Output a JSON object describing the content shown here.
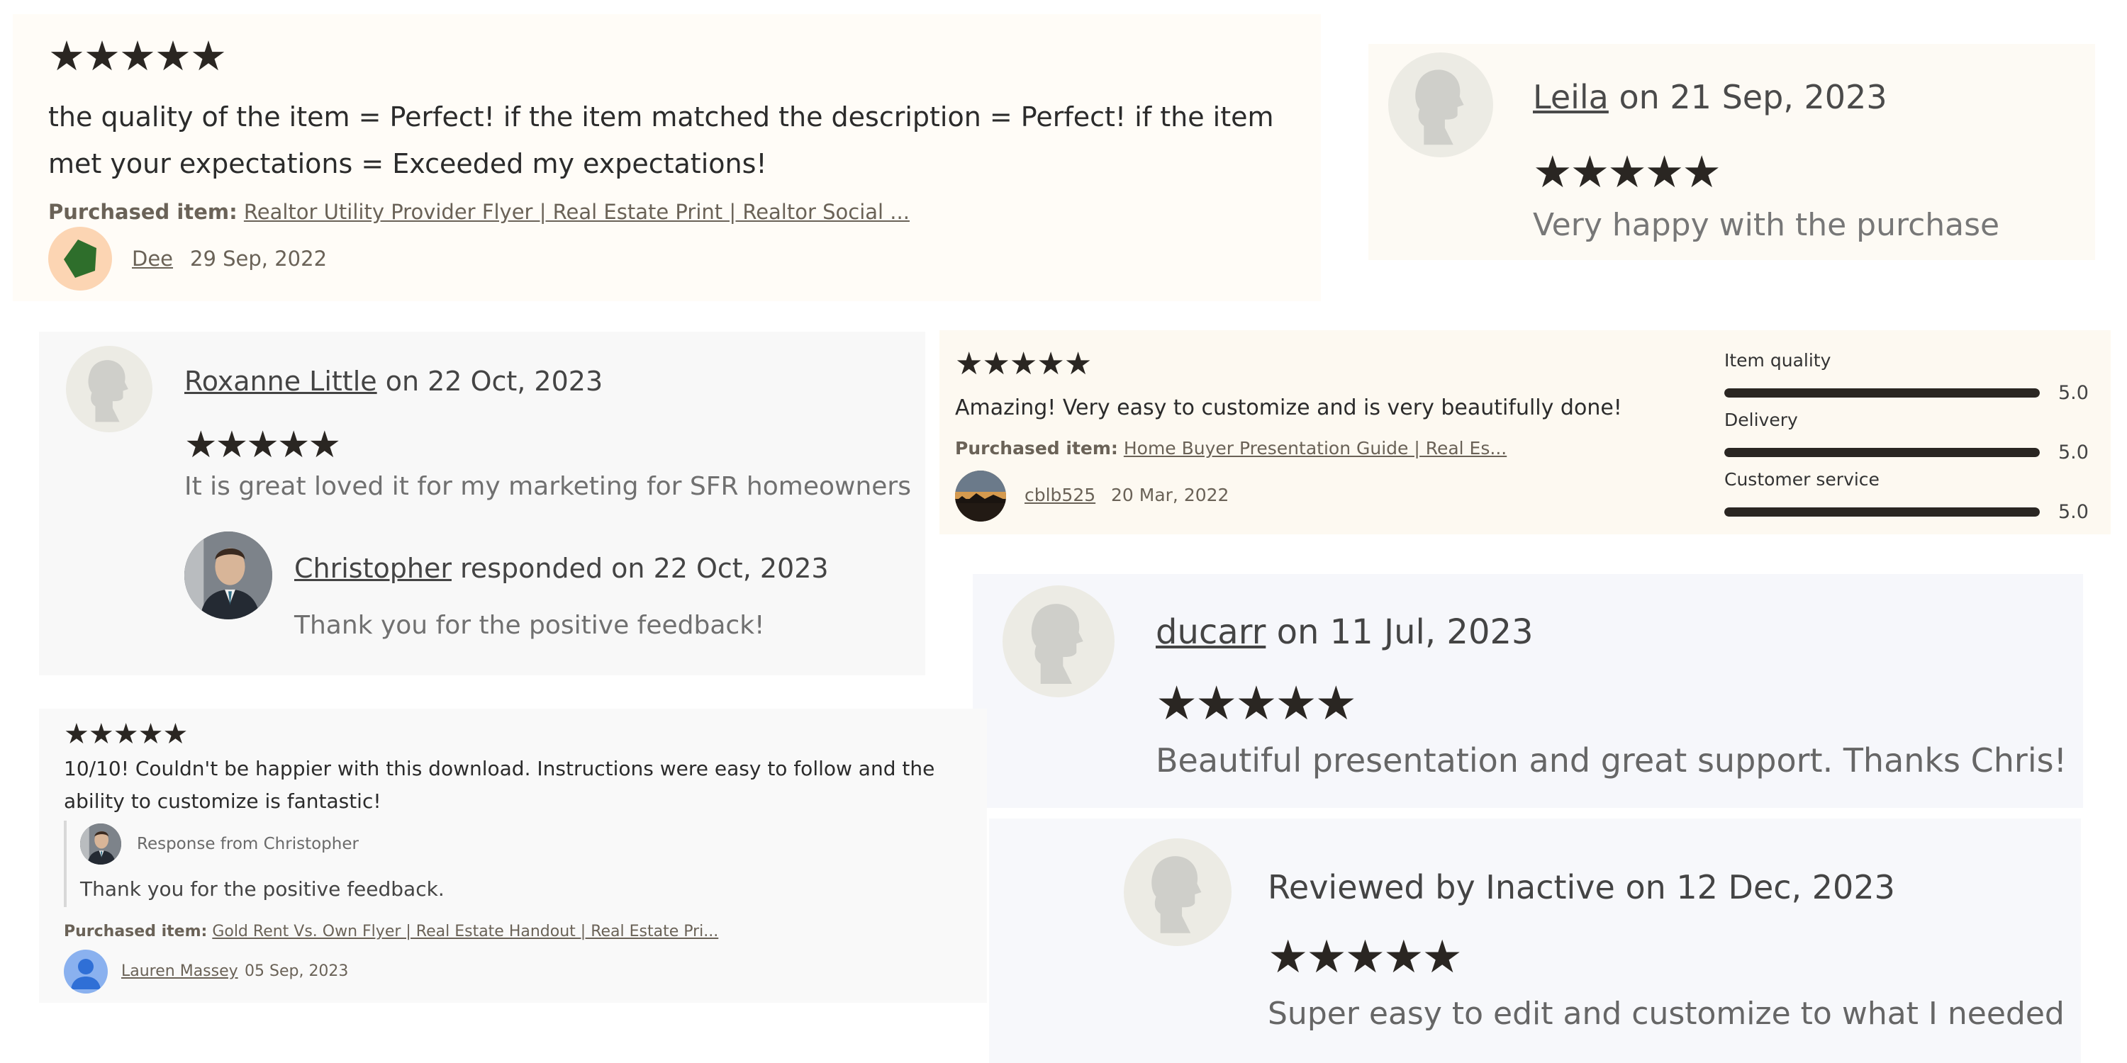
{
  "star_glyph": "★",
  "reviews": [
    {
      "rating": 5,
      "text": "the quality of the item = Perfect! if the item matched the description = Perfect! if the item met your expectations = Exceeded my expectations!",
      "purchased_label": "Purchased item:",
      "purchased_item": "Realtor Utility Provider Flyer | Real Estate Print | Realtor Social ...",
      "reviewer": "Dee",
      "date": "29 Sep, 2022"
    },
    {
      "rating": 5,
      "reviewer": "Leila",
      "date_text": " on 21 Sep, 2023",
      "text": "Very happy with the purchase"
    },
    {
      "rating": 5,
      "reviewer": "Roxanne Little",
      "date_text": " on 22 Oct, 2023",
      "text": "It is great loved it for my marketing for SFR homeowners",
      "response": {
        "name": "Christopher",
        "date_text": " responded on 22 Oct, 2023",
        "text": "Thank you for the positive feedback!"
      }
    },
    {
      "rating": 5,
      "text": "Amazing! Very easy to customize and is very beautifully done!",
      "purchased_label": "Purchased item:",
      "purchased_item": "Home Buyer Presentation Guide | Real Es...",
      "reviewer": "cblb525",
      "date": "20 Mar, 2022",
      "ratings": [
        {
          "label": "Item quality",
          "value": "5.0",
          "fraction": 1.0
        },
        {
          "label": "Delivery",
          "value": "5.0",
          "fraction": 1.0
        },
        {
          "label": "Customer service",
          "value": "5.0",
          "fraction": 1.0
        }
      ]
    },
    {
      "rating": 5,
      "reviewer": "ducarr",
      "date_text": " on 11 Jul, 2023",
      "text": "Beautiful presentation and great support. Thanks Chris!"
    },
    {
      "rating": 5,
      "text": "10/10! Couldn't be happier with this download. Instructions were easy to follow and the ability to customize is fantastic!",
      "response": {
        "label": "Response from Christopher",
        "text": "Thank you for the positive feedback."
      },
      "purchased_label": "Purchased item:",
      "purchased_item": "Gold Rent Vs. Own Flyer | Real Estate Handout | Real Estate Pri...",
      "reviewer": "Lauren Massey",
      "date": "05 Sep, 2023"
    },
    {
      "rating": 5,
      "head": "Reviewed by Inactive on 12 Dec, 2023",
      "text": "Super easy to edit and customize to what I needed"
    }
  ],
  "colors": {
    "star": "#2a2622",
    "card_cream": "#fffcf7",
    "card_grey": "#f8f8f8",
    "card_blue": "#f6f7fb",
    "muted_text": "#6a6257"
  },
  "icons": {
    "placeholder_avatar": "person-silhouette-icon",
    "user_avatar": "user-circle-icon"
  }
}
